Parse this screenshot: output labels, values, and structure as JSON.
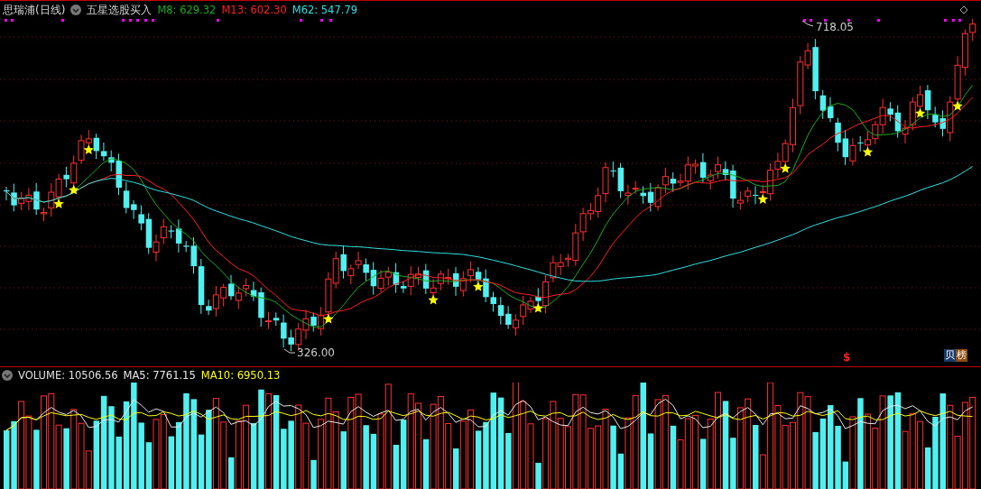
{
  "title": "思瑞浦(日线)",
  "indicator": "五星选股买入",
  "price_lines": [
    {
      "text": "M8: 629.32",
      "color": "#1faa1f"
    },
    {
      "text": "M13: 602.30",
      "color": "#ff2020"
    },
    {
      "text": "M62: 547.79",
      "color": "#30e0e0"
    }
  ],
  "high_label": "718.05",
  "low_label": "326.00",
  "marker": {
    "text": "$",
    "color": "#ff2020"
  },
  "badge": [
    {
      "text": "贝",
      "color": "#1a3a6a"
    },
    {
      "text": "榜",
      "color": "#8a4a10"
    }
  ],
  "volume": {
    "text": "VOLUME: 10506.56",
    "averages": [
      {
        "text": "MA5: 7761.15",
        "color": "#e8e8e8"
      },
      {
        "text": "MA10: 6950.13",
        "color": "#ffff00"
      }
    ]
  }
}
